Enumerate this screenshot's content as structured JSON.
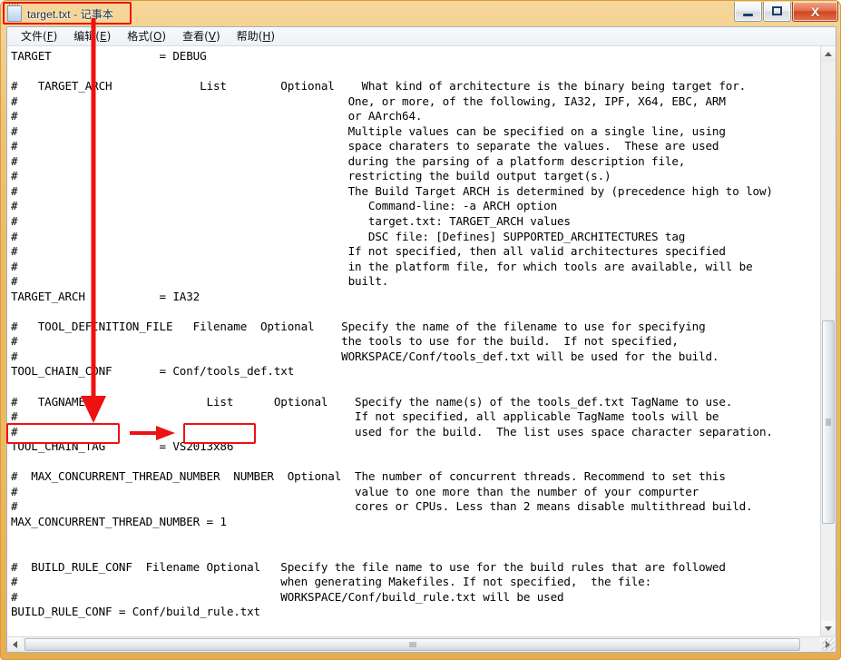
{
  "window": {
    "title": "target.txt - 记事本",
    "app_icon": "notepad-icon",
    "controls": {
      "minimize_label": "–",
      "maximize_label": "□",
      "close_label": "X"
    }
  },
  "menu": {
    "items": [
      {
        "label": "文件(F)",
        "text": "文件(",
        "accel": "F",
        "tail": ")"
      },
      {
        "label": "编辑(E)",
        "text": "编辑(",
        "accel": "E",
        "tail": ")"
      },
      {
        "label": "格式(O)",
        "text": "格式(",
        "accel": "O",
        "tail": ")"
      },
      {
        "label": "查看(V)",
        "text": "查看(",
        "accel": "V",
        "tail": ")"
      },
      {
        "label": "帮助(H)",
        "text": "帮助(",
        "accel": "H",
        "tail": ")"
      }
    ]
  },
  "editor": {
    "filename": "target.txt",
    "content": "TARGET                = DEBUG\n\n#   TARGET_ARCH             List        Optional    What kind of architecture is the binary being target for.\n#                                                 One, or more, of the following, IA32, IPF, X64, EBC, ARM\n#                                                 or AArch64.\n#                                                 Multiple values can be specified on a single line, using\n#                                                 space charaters to separate the values.  These are used\n#                                                 during the parsing of a platform description file,\n#                                                 restricting the build output target(s.)\n#                                                 The Build Target ARCH is determined by (precedence high to low)\n#                                                    Command-line: -a ARCH option\n#                                                    target.txt: TARGET_ARCH values\n#                                                    DSC file: [Defines] SUPPORTED_ARCHITECTURES tag\n#                                                 If not specified, then all valid architectures specified\n#                                                 in the platform file, for which tools are available, will be\n#                                                 built.\nTARGET_ARCH           = IA32\n\n#   TOOL_DEFINITION_FILE   Filename  Optional    Specify the name of the filename to use for specifying\n#                                                the tools to use for the build.  If not specified,\n#                                                WORKSPACE/Conf/tools_def.txt will be used for the build.\nTOOL_CHAIN_CONF       = Conf/tools_def.txt\n\n#   TAGNAME                  List      Optional    Specify the name(s) of the tools_def.txt TagName to use.\n#                                                  If not specified, all applicable TagName tools will be\n#                                                  used for the build.  The list uses space character separation.\nTOOL_CHAIN_TAG        = VS2013x86\n\n#  MAX_CONCURRENT_THREAD_NUMBER  NUMBER  Optional  The number of concurrent threads. Recommend to set this\n#                                                  value to one more than the number of your compurter\n#                                                  cores or CPUs. Less than 2 means disable multithread build.\nMAX_CONCURRENT_THREAD_NUMBER = 1\n\n\n#  BUILD_RULE_CONF  Filename Optional   Specify the file name to use for the build rules that are followed\n#                                       when generating Makefiles. If not specified,  the file:\n#                                       WORKSPACE/Conf/build_rule.txt will be used\nBUILD_RULE_CONF = Conf/build_rule.txt"
  },
  "scrollbars": {
    "vertical": {
      "up_arrow": "scroll-up-arrow",
      "down_arrow": "scroll-down-arrow"
    },
    "horizontal": {
      "left_arrow": "scroll-left-arrow",
      "right_arrow": "scroll-right-arrow"
    }
  },
  "annotations": {
    "color": "#ee1111",
    "title_highlight": "target.txt - 记事本",
    "tag_highlight": "TOOL_CHAIN_TAG",
    "value_highlight": "VS2013x86",
    "down_arrow_name": "red-down-arrow",
    "right_arrow_name": "red-right-arrow"
  }
}
